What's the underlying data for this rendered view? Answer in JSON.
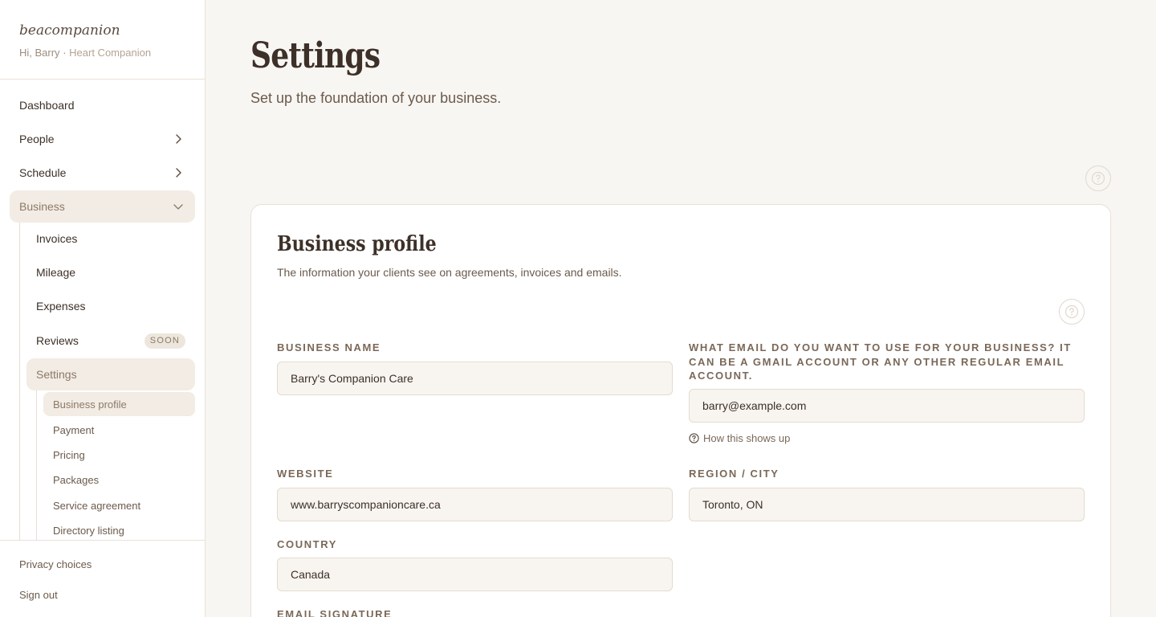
{
  "app": {
    "brand": "beacompanion",
    "greeting": "Hi, Barry",
    "separator": "·",
    "role": "Heart Companion"
  },
  "nav": {
    "dashboard": "Dashboard",
    "people": "People",
    "schedule": "Schedule",
    "business": "Business",
    "business_children": {
      "invoices": "Invoices",
      "mileage": "Mileage",
      "expenses": "Expenses",
      "reviews": "Reviews",
      "reviews_badge": "SOON",
      "settings": "Settings"
    },
    "settings_children": {
      "business_profile": "Business profile",
      "payment": "Payment",
      "pricing": "Pricing",
      "packages": "Packages",
      "service_agreement": "Service agreement",
      "directory_listing": "Directory listing"
    },
    "bottom": {
      "privacy": "Privacy choices",
      "sign_out": "Sign out"
    }
  },
  "page": {
    "title": "Settings",
    "subtitle": "Set up the foundation of your business."
  },
  "card": {
    "title": "Business profile",
    "subtitle": "The information your clients see on agreements, invoices and emails.",
    "fields": {
      "business_name": {
        "label": "Business name",
        "value": "Barry's Companion Care"
      },
      "email": {
        "label": "What email do you want to use for your business? It can be a Gmail account or any other regular email account.",
        "value": "barry@example.com",
        "hint": "How this shows up"
      },
      "website": {
        "label": "Website",
        "value": "www.barryscompanioncare.ca"
      },
      "region": {
        "label": "Region / City",
        "value": "Toronto, ON"
      },
      "country": {
        "label": "Country",
        "value": "Canada"
      },
      "signature": {
        "label": "Email signature"
      }
    }
  },
  "colors": {
    "background": "#f8f6f2",
    "accent": "#8c7a68",
    "active_bg": "#f2ece4"
  }
}
